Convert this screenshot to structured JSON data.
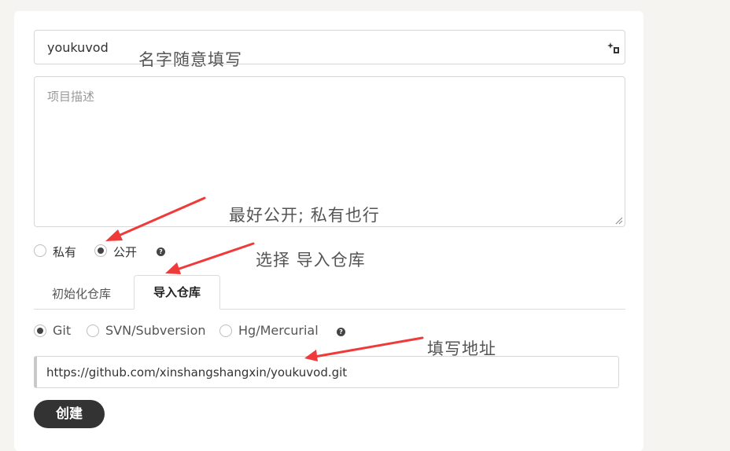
{
  "form": {
    "name_value": "youkuvod",
    "description_placeholder": "项目描述",
    "visibility": {
      "options": [
        "私有",
        "公开"
      ],
      "selected": "公开"
    },
    "tabs": [
      "初始化仓库",
      "导入仓库"
    ],
    "active_tab": "导入仓库",
    "vcs": {
      "options": [
        "Git",
        "SVN/Subversion",
        "Hg/Mercurial"
      ],
      "selected": "Git"
    },
    "repo_url": "https://github.com/xinshangshangxin/youkuvod.git",
    "create_label": "创建",
    "help_glyph": "?"
  },
  "annotations": {
    "name_note": "名字随意填写",
    "visibility_note": "最好公开; 私有也行",
    "import_note": "选择 导入仓库",
    "url_note": "填写地址"
  },
  "colors": {
    "arrow": "#f03a3a",
    "button": "#333333",
    "page_bg": "#f5f4f1"
  }
}
